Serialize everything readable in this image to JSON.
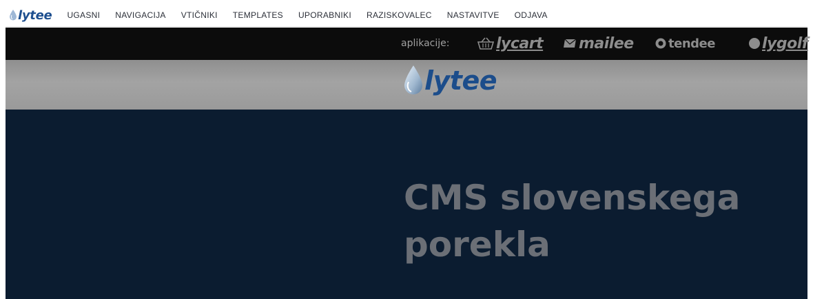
{
  "admin": {
    "logo_text": "lytee",
    "nav": [
      "UGASNI",
      "NAVIGACIJA",
      "VTIČNIKI",
      "TEMPLATES",
      "UPORABNIKI",
      "RAZISKOVALEC",
      "NASTAVITVE",
      "ODJAVA"
    ]
  },
  "apps": {
    "label": "aplikacije:",
    "items": [
      {
        "name": "lycart",
        "icon": "basket-icon"
      },
      {
        "name": "mailee",
        "icon": "envelope-icon"
      },
      {
        "name": "tendee",
        "icon": "circle-icon"
      },
      {
        "name": "lygolf",
        "icon": "golf-ball-icon"
      }
    ]
  },
  "header": {
    "logo_text": "lytee"
  },
  "hero": {
    "headline": "CMS slovenskega porekla"
  },
  "colors": {
    "brand_blue": "#1e4f8f",
    "hero_bg": "#0b1c30",
    "apps_bar_bg": "#0c0c0c"
  }
}
